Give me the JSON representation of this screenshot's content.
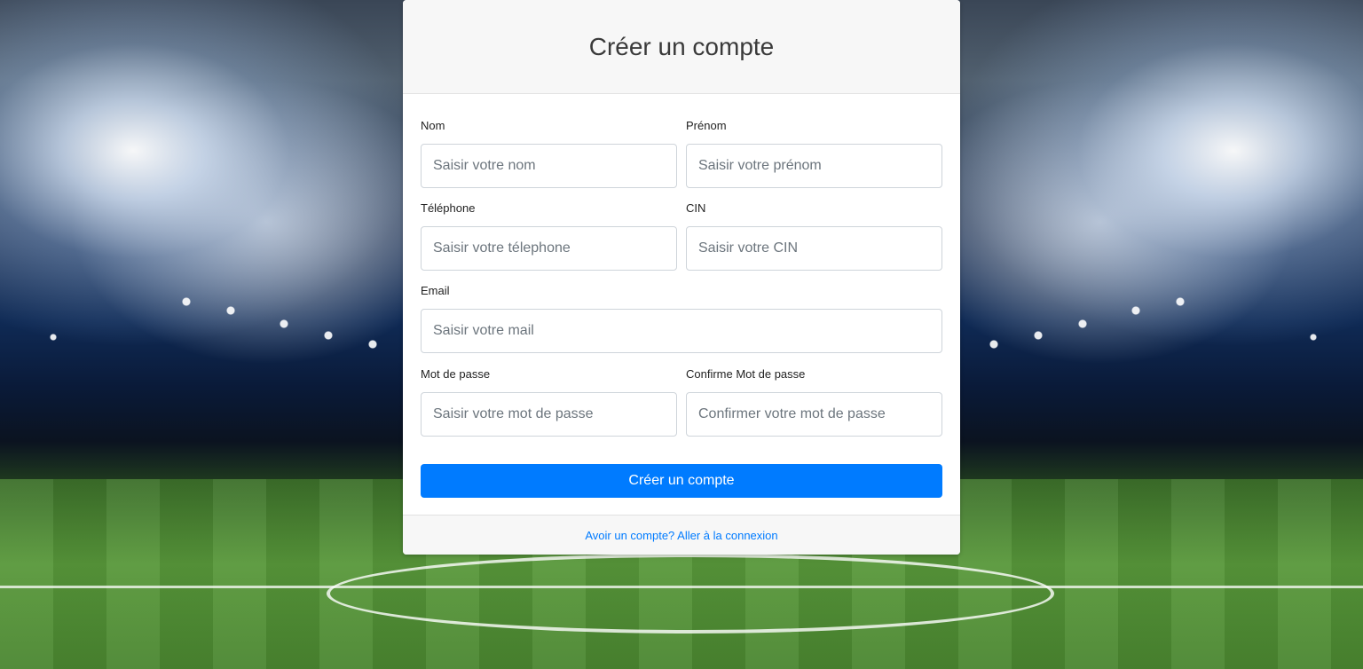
{
  "form": {
    "title": "Créer un compte",
    "fields": {
      "nom": {
        "label": "Nom",
        "placeholder": "Saisir votre nom",
        "value": ""
      },
      "prenom": {
        "label": "Prénom",
        "placeholder": "Saisir votre prénom",
        "value": ""
      },
      "telephone": {
        "label": "Téléphone",
        "placeholder": "Saisir votre télephone",
        "value": ""
      },
      "cin": {
        "label": "CIN",
        "placeholder": "Saisir votre CIN",
        "value": ""
      },
      "email": {
        "label": "Email",
        "placeholder": "Saisir votre mail",
        "value": ""
      },
      "password": {
        "label": "Mot de passe",
        "placeholder": "Saisir votre mot de passe",
        "value": ""
      },
      "confirm_password": {
        "label": "Confirme Mot de passe",
        "placeholder": "Confirmer votre mot de passe",
        "value": ""
      }
    },
    "submit_label": "Créer un compte",
    "footer_link": "Avoir un compte? Aller à la connexion"
  },
  "colors": {
    "primary": "#007bff",
    "header_bg": "#f7f7f7",
    "pitch_green": "#58983a"
  }
}
